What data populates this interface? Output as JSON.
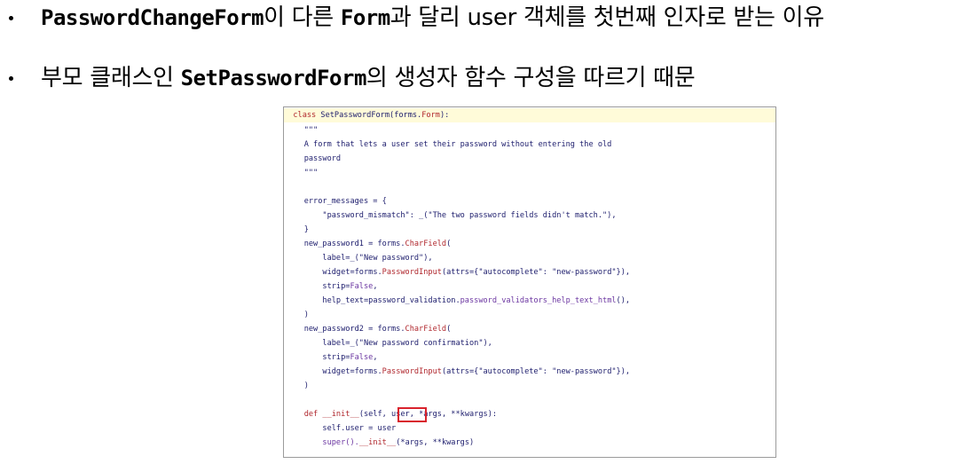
{
  "bullets": [
    {
      "parts": [
        "PasswordChangeForm",
        "이 다른 ",
        "Form",
        "과 달리 user 객체를 첫번째 인자로 받는 이유"
      ]
    },
    {
      "parts": [
        "부모 클래스인 ",
        "SetPasswordForm",
        "의 생성자 함수 구성을 따르기 때문"
      ]
    }
  ],
  "code": {
    "lines": [
      [
        "",
        "class ",
        "SetPasswordForm(forms.",
        "Form",
        "):"
      ],
      [
        "    ",
        "\"\"\""
      ],
      [
        "    ",
        "A form that lets a user set their password without entering the old"
      ],
      [
        "    ",
        "password"
      ],
      [
        "    ",
        "\"\"\""
      ],
      [
        ""
      ],
      [
        "    ",
        "error_messages = {"
      ],
      [
        "        ",
        "\"password_mismatch\": _(\"The two password fields didn't match.\"),"
      ],
      [
        "    ",
        "}"
      ],
      [
        "    ",
        "new_password1 = forms.",
        "CharField",
        "("
      ],
      [
        "        ",
        "label=_(\"New password\"),"
      ],
      [
        "        ",
        "widget=forms.",
        "PasswordInput",
        "(attrs={\"autocomplete\": \"new-password\"}),"
      ],
      [
        "        ",
        "strip=",
        "False",
        ","
      ],
      [
        "        ",
        "help_text=password_validation.",
        "password_validators_help_text_html",
        "(),"
      ],
      [
        "    ",
        ")"
      ],
      [
        "    ",
        "new_password2 = forms.",
        "CharField",
        "("
      ],
      [
        "        ",
        "label=_(\"New password confirmation\"),"
      ],
      [
        "        ",
        "strip=",
        "False",
        ","
      ],
      [
        "        ",
        "widget=forms.",
        "PasswordInput",
        "(attrs={\"autocomplete\": \"new-password\"}),"
      ],
      [
        "    ",
        ")"
      ],
      [
        ""
      ],
      [
        "    ",
        "def ",
        "__init__",
        "(self, ",
        "user,",
        " *args, **kwargs):"
      ],
      [
        "        ",
        "self.user = user"
      ],
      [
        "        ",
        "super().",
        "__init__",
        "(*args, **kwargs)"
      ]
    ]
  },
  "colors": {
    "keyword": "#b0272d",
    "function": "#6b36a1",
    "highlight_box": "#d9232d",
    "first_line_bg": "#fffbd9"
  }
}
